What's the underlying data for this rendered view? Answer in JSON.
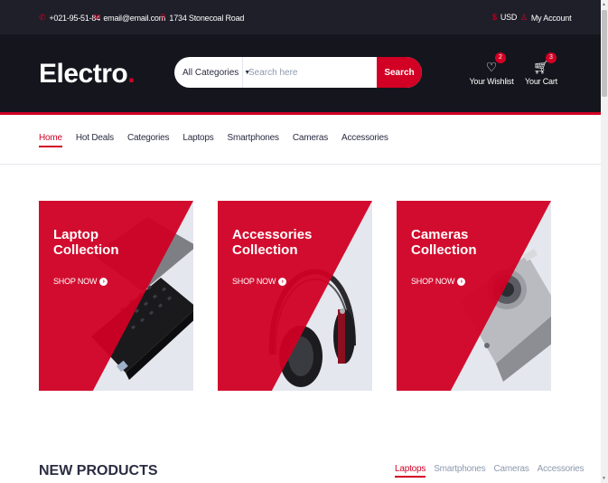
{
  "topbar": {
    "phone": "+021-95-51-84",
    "email": "email@email.com",
    "address": "1734 Stonecoal Road",
    "currency": "USD",
    "account": "My Account",
    "phone_icon": "phone-icon",
    "email_icon": "envelope-icon",
    "address_icon": "map-marker-icon",
    "currency_icon": "dollar-icon",
    "account_icon": "user-icon"
  },
  "header": {
    "logo_text": "Electro",
    "logo_dot": ".",
    "category_selected": "All Categories",
    "search_placeholder": "Search here",
    "search_button": "Search",
    "wishlist_label": "Your Wishlist",
    "wishlist_count": "2",
    "cart_label": "Your Cart",
    "cart_count": "3"
  },
  "nav": {
    "items": [
      "Home",
      "Hot Deals",
      "Categories",
      "Laptops",
      "Smartphones",
      "Cameras",
      "Accessories"
    ],
    "active": "Home"
  },
  "collections": [
    {
      "title_line1": "Laptop",
      "title_line2": "Collection",
      "cta": "SHOP NOW"
    },
    {
      "title_line1": "Accessories",
      "title_line2": "Collection",
      "cta": "SHOP NOW"
    },
    {
      "title_line1": "Cameras",
      "title_line2": "Collection",
      "cta": "SHOP NOW"
    }
  ],
  "new_products": {
    "title": "NEW PRODUCTS",
    "tabs": [
      "Laptops",
      "Smartphones",
      "Cameras",
      "Accessories"
    ],
    "active": "Laptops"
  },
  "colors": {
    "accent": "#D10024",
    "topbar_bg": "#1e1f29",
    "header_bg": "#15161d",
    "text": "#2b2d42"
  }
}
